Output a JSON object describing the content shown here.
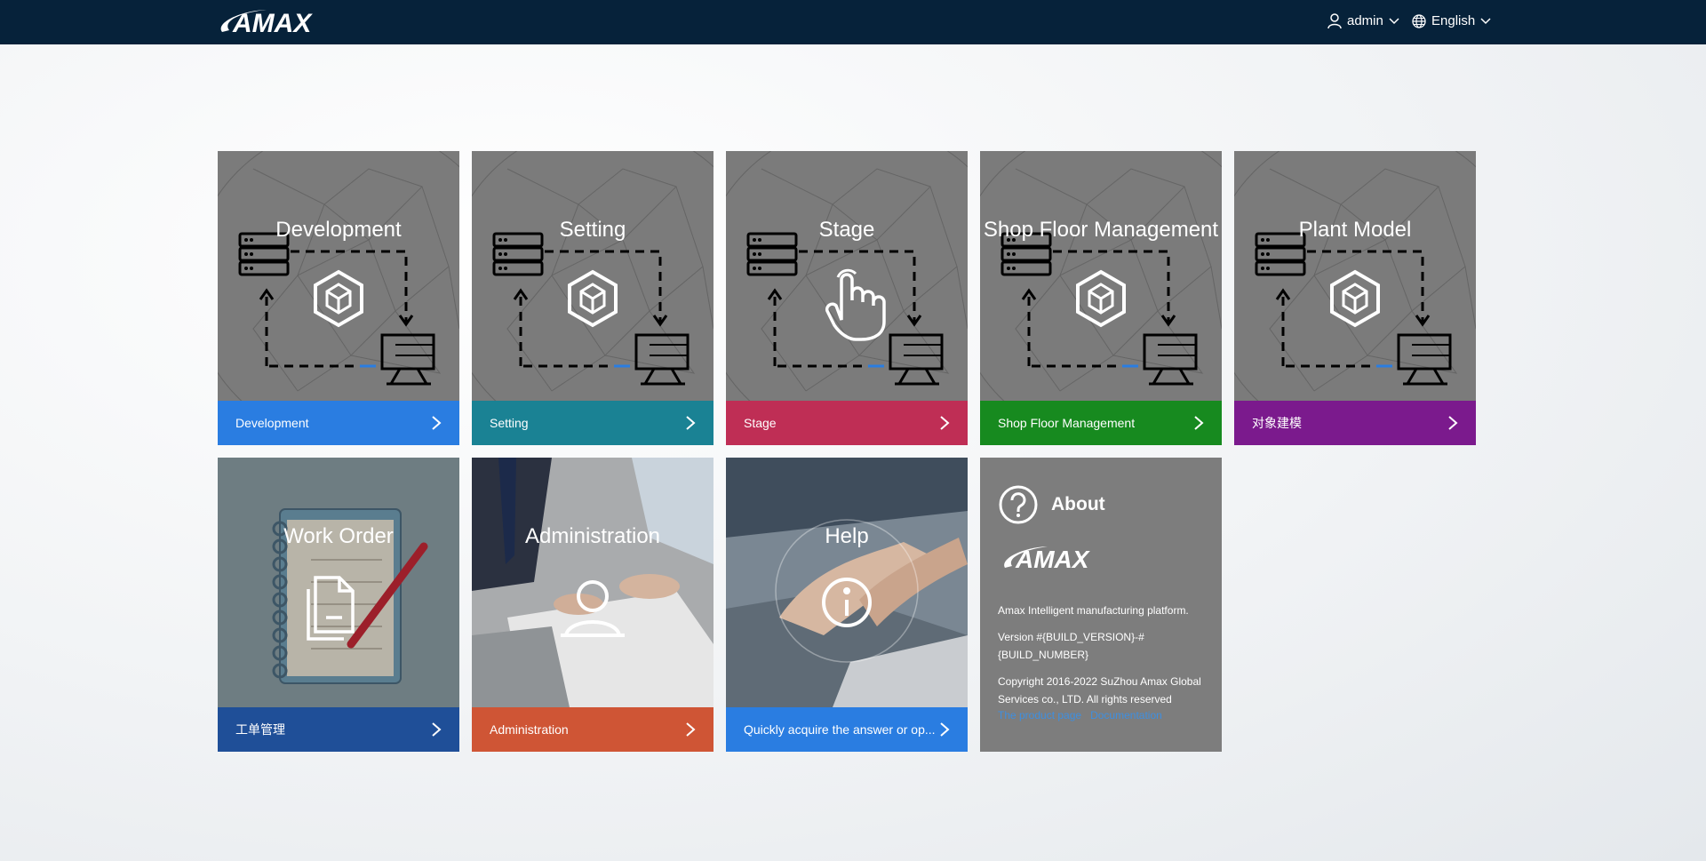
{
  "header": {
    "brand": "AMAX",
    "user": "admin",
    "language": "English"
  },
  "tiles": [
    {
      "title": "Development",
      "footer": "Development",
      "color": "#2a7de1",
      "icon": "cube-flow-icon"
    },
    {
      "title": "Setting",
      "footer": "Setting",
      "color": "#1a8294",
      "icon": "cube-flow-icon"
    },
    {
      "title": "Stage",
      "footer": "Stage",
      "color": "#bf2e55",
      "icon": "hand-pointer-icon"
    },
    {
      "title": "Shop Floor Management",
      "footer": "Shop Floor Management",
      "color": "#178a1f",
      "icon": "cube-flow-icon"
    },
    {
      "title": "Plant Model",
      "footer": "对象建模",
      "color": "#7b1a8d",
      "icon": "cube-flow-icon"
    },
    {
      "title": "Work Order",
      "footer": "工单管理",
      "color": "#1f4f98",
      "icon": "documents-icon"
    },
    {
      "title": "Administration",
      "footer": "Administration",
      "color": "#cf5535",
      "icon": "person-icon"
    },
    {
      "title": "Help",
      "footer": "Quickly acquire the answer or op...",
      "color": "#2a7de1",
      "icon": "info-icon"
    }
  ],
  "about": {
    "title": "About",
    "brand": "AMAX",
    "description": "Amax Intelligent manufacturing platform.",
    "version_line1": "Version #{BUILD_VERSION}-#",
    "version_line2": "{BUILD_NUMBER}",
    "copyright_line1": "Copyright 2016-2022 SuZhou Amax Global",
    "copyright_line2": "Services co., LTD. All rights reserved",
    "link1": "The product page",
    "link2": "Documentation"
  }
}
